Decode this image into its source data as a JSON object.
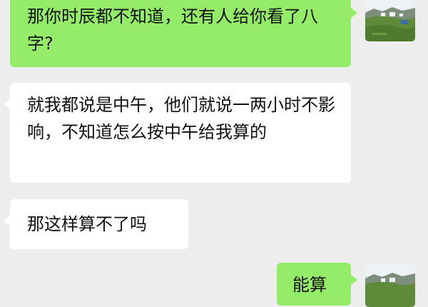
{
  "chat": {
    "messages": [
      {
        "sender": "self",
        "text": "那你时辰都不知道，还有人给你看了八字?"
      },
      {
        "sender": "other",
        "text": "就我都说是中午，他们就说一两小时不影响，不知道怎么按中午给我算的"
      },
      {
        "sender": "other",
        "text": "那这样算不了吗"
      },
      {
        "sender": "self",
        "text": "能算"
      }
    ]
  },
  "colors": {
    "background": "#ededed",
    "self_bubble": "#95ec69",
    "other_bubble": "#ffffff"
  },
  "avatar_icon": "landscape-avatar-icon"
}
